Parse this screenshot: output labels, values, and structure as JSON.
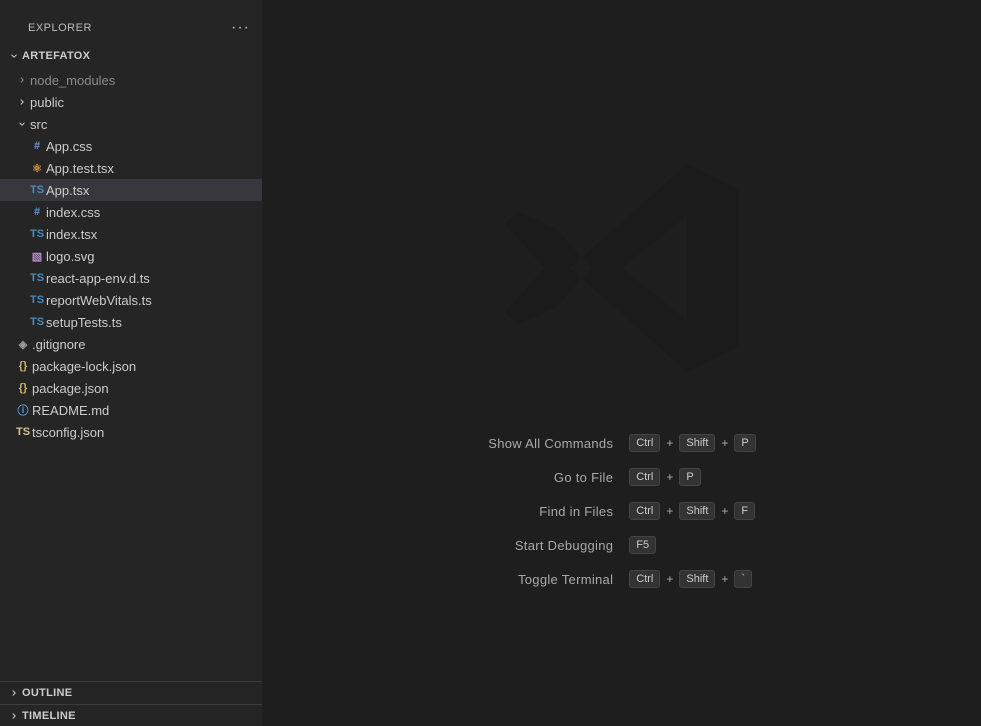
{
  "explorer": {
    "title": "EXPLORER",
    "projectName": "ARTEFATOX",
    "outline": "OUTLINE",
    "timeline": "TIMELINE"
  },
  "tree": {
    "node_modules": "node_modules",
    "public": "public",
    "src": "src",
    "files": {
      "app_css": "App.css",
      "app_test": "App.test.tsx",
      "app_tsx": "App.tsx",
      "index_css": "index.css",
      "index_tsx": "index.tsx",
      "logo_svg": "logo.svg",
      "react_env": "react-app-env.d.ts",
      "report": "reportWebVitals.ts",
      "setup": "setupTests.ts",
      "gitignore": ".gitignore",
      "pkg_lock": "package-lock.json",
      "pkg": "package.json",
      "readme": "README.md",
      "tsconfig": "tsconfig.json"
    }
  },
  "welcome": {
    "show_all": "Show All Commands",
    "goto_file": "Go to File",
    "find_files": "Find in Files",
    "start_debug": "Start Debugging",
    "toggle_term": "Toggle Terminal"
  },
  "keys": {
    "ctrl": "Ctrl",
    "shift": "Shift",
    "p": "P",
    "f": "F",
    "f5": "F5",
    "backtick": "`"
  }
}
